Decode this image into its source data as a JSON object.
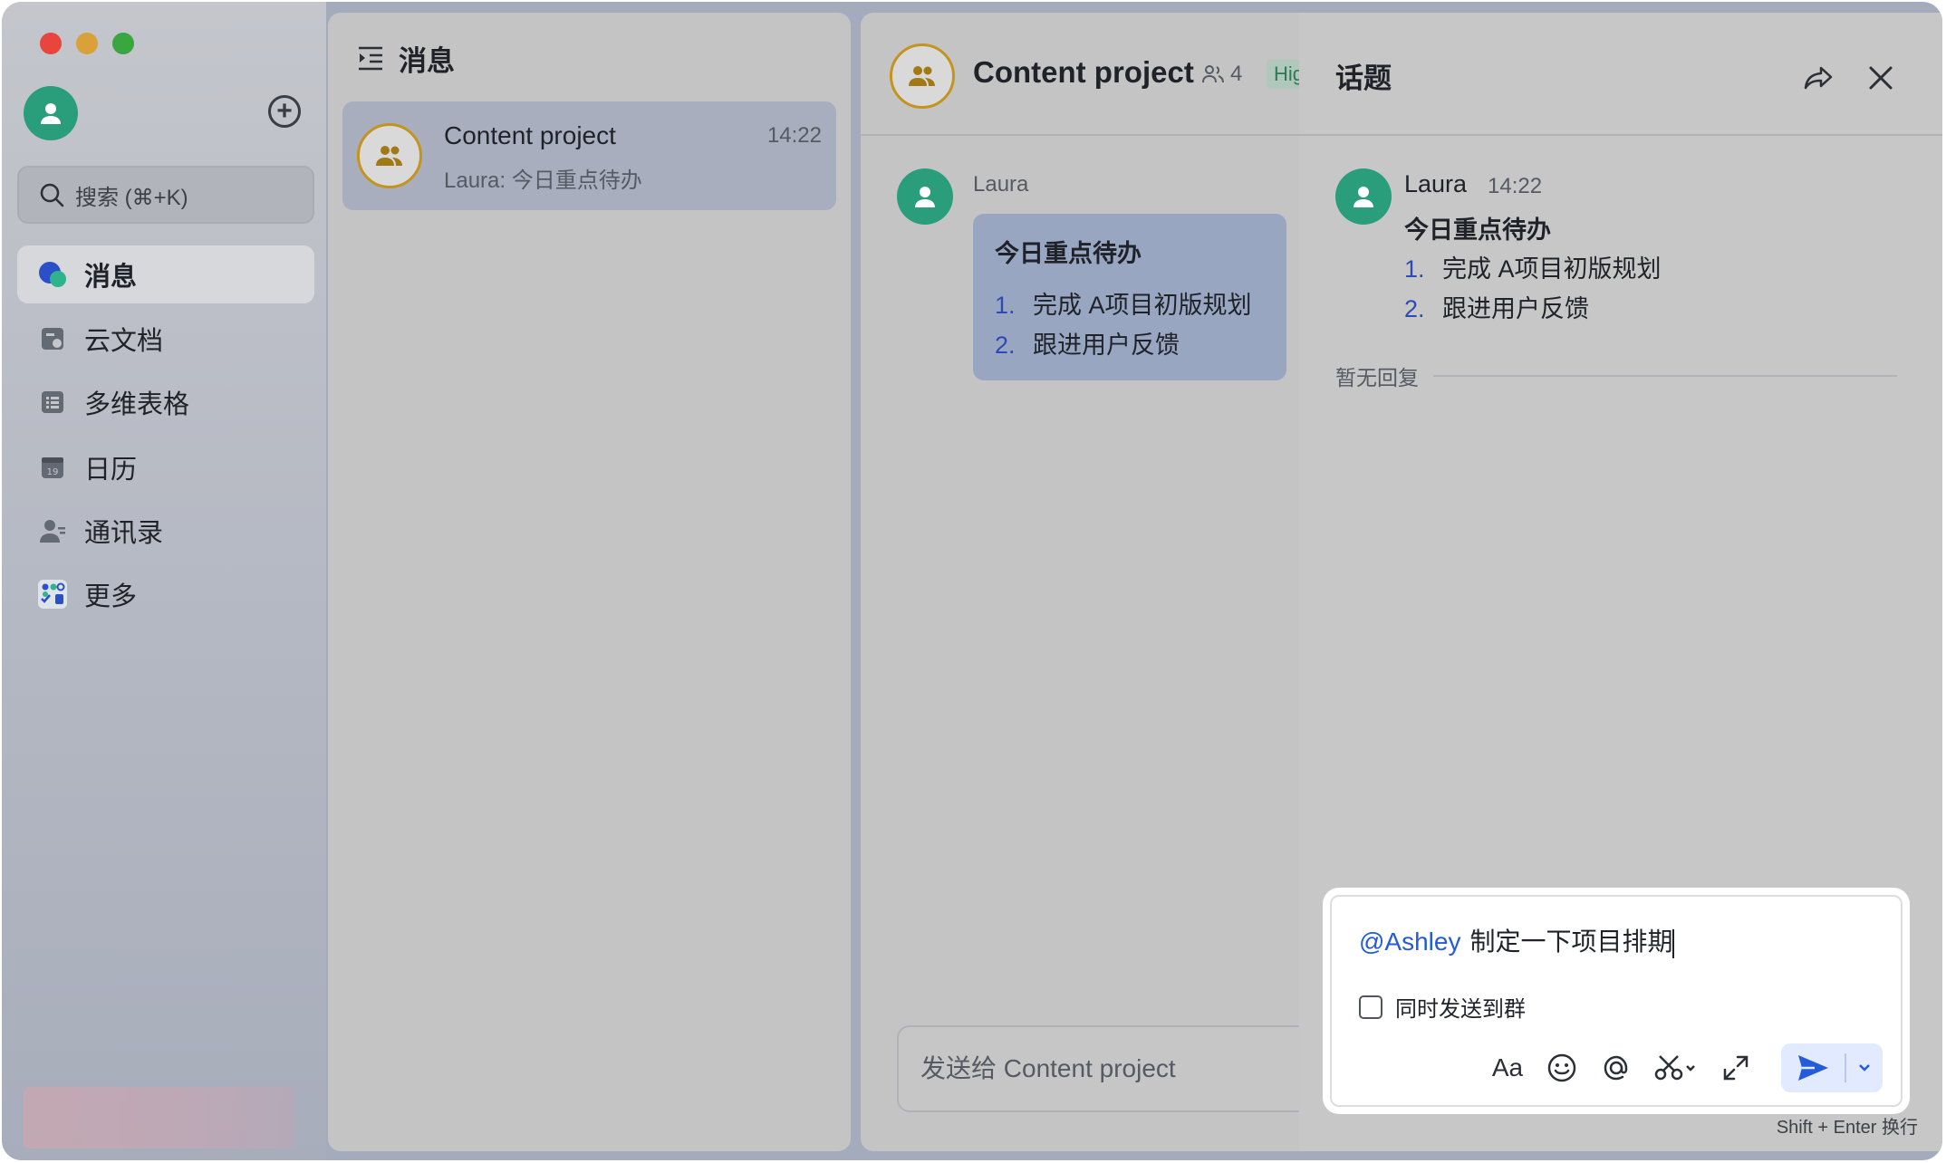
{
  "sidebar": {
    "search_placeholder": "搜索 (⌘+K)",
    "items": [
      {
        "label": "消息",
        "icon": "messages-icon",
        "active": true
      },
      {
        "label": "云文档",
        "icon": "docs-icon"
      },
      {
        "label": "多维表格",
        "icon": "base-icon"
      },
      {
        "label": "日历",
        "icon": "calendar-icon"
      },
      {
        "label": "通讯录",
        "icon": "contacts-icon"
      },
      {
        "label": "更多",
        "icon": "more-apps-icon"
      }
    ],
    "calendar_day": "19"
  },
  "message_list": {
    "header": "消息",
    "chats": [
      {
        "title": "Content project",
        "time": "14:22",
        "preview": "Laura: 今日重点待办"
      }
    ]
  },
  "chat": {
    "title": "Content project",
    "member_count": "4",
    "tag": "Hig",
    "message": {
      "sender": "Laura",
      "title": "今日重点待办",
      "items": [
        {
          "num": "1.",
          "text": "完成 A项目初版规划"
        },
        {
          "num": "2.",
          "text": "跟进用户反馈"
        }
      ]
    },
    "composer_placeholder": "发送给 Content project"
  },
  "thread": {
    "title": "话题",
    "sender": "Laura",
    "time": "14:22",
    "message_title": "今日重点待办",
    "items": [
      {
        "num": "1.",
        "text": "完成 A项目初版规划"
      },
      {
        "num": "2.",
        "text": "跟进用户反馈"
      }
    ],
    "no_reply": "暂无回复",
    "reply": {
      "mention": "@Ashley",
      "text": "制定一下项目排期",
      "also_send_label": "同时发送到群",
      "font_tool_label": "Aa"
    },
    "hint": "Shift + Enter 换行"
  },
  "colors": {
    "accent": "#245bdb",
    "avatar_green": "#2a9d7a",
    "group_ring": "#c49420"
  }
}
